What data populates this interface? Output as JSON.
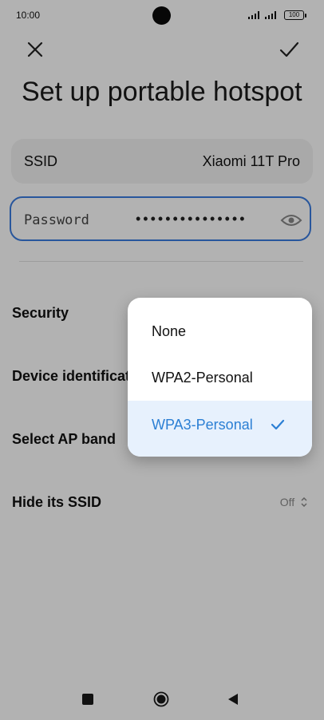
{
  "status_bar": {
    "time": "10:00",
    "battery": "100"
  },
  "header": {
    "title": "Set up portable hotspot"
  },
  "ssid": {
    "label": "SSID",
    "value": "Xiaomi 11T Pro"
  },
  "password": {
    "label": "Password",
    "masked_value": "•••••••••••••••"
  },
  "settings": {
    "security_label": "Security",
    "device_label": "Device identificat",
    "apband_label": "Select AP band",
    "hide_ssid_label": "Hide its SSID",
    "hide_ssid_value": "Off"
  },
  "security_menu": {
    "options": [
      "None",
      "WPA2-Personal",
      "WPA3-Personal"
    ],
    "selected": "WPA3-Personal"
  },
  "colors": {
    "accent": "#2b7fd4",
    "focus_border": "#3a7be0",
    "selected_bg": "#e7f1fd"
  },
  "icons": [
    "close-icon",
    "check-icon",
    "eye-icon",
    "square-icon",
    "circle-icon",
    "back-triangle-icon"
  ]
}
